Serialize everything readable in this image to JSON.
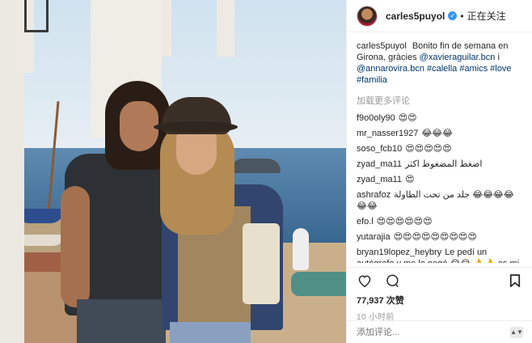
{
  "header": {
    "username": "carles5puyol",
    "follow_status": "正在关注"
  },
  "caption": {
    "username": "carles5puyol",
    "text": "Bonito fin de semana en Girona, gràcies",
    "mention1": "@xavieraguilar.bcn",
    "sep": "i",
    "mention2": "@annarovira.bcn",
    "tags": "#calella #amics #love #familia"
  },
  "load_more": "加载更多评论",
  "comments": [
    {
      "user": "f9o0oly90",
      "text": "😍😍"
    },
    {
      "user": "mr_nasser1927",
      "text": "😂😂😂"
    },
    {
      "user": "soso_fcb10",
      "text": "😍😍😍😍😍"
    },
    {
      "user": "zyad_ma11",
      "text": "اضغط المضغوط اكثر"
    },
    {
      "user": "zyad_ma11",
      "text": "😍"
    },
    {
      "user": "ashrafoz",
      "text": "جلد من تحت الطاولة 😂😂😂😂😂😂"
    },
    {
      "user": "efo.l",
      "text": "😍😍😍😍😍😍"
    },
    {
      "user": "yutarajia",
      "text": "😍😍😍😍😍😍😍😍😍"
    },
    {
      "user": "bryan19lopez_heybry",
      "text": "Le pedí un autógrafo y me lo negó 😂😂 👌👌 es mi ejemplo a seguir y no m firmó mi camisola"
    }
  ],
  "likes": "77,937 次赞",
  "time": "10 小时前",
  "add_comment_placeholder": "添加评论...",
  "icons": {
    "like": "heart-icon",
    "comment": "comment-icon",
    "save": "bookmark-icon",
    "options": "more-options-icon",
    "verified": "verified-badge-icon"
  }
}
